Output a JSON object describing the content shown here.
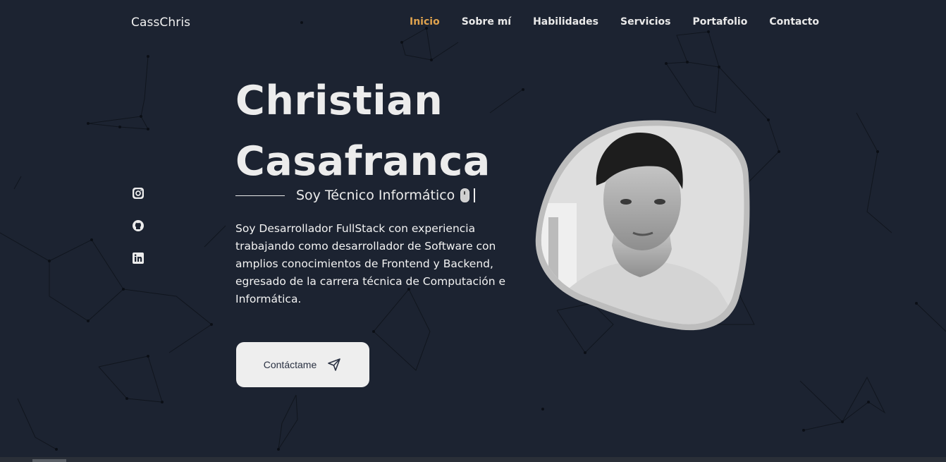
{
  "brand": {
    "name": "CassChris"
  },
  "nav": {
    "items": [
      {
        "label": "Inicio",
        "active": true
      },
      {
        "label": "Sobre mí",
        "active": false
      },
      {
        "label": "Habilidades",
        "active": false
      },
      {
        "label": "Servicios",
        "active": false
      },
      {
        "label": "Portafolio",
        "active": false
      },
      {
        "label": "Contacto",
        "active": false
      }
    ]
  },
  "social": [
    "instagram-icon",
    "github-icon",
    "linkedin-icon"
  ],
  "hero": {
    "name_line1": "Christian",
    "name_line2": "Casafranca",
    "subtitle": "Soy  Técnico Informático",
    "description": "Soy Desarrollador FullStack con experiencia trabajando como desarrollador de Software con amplios conocimientos de Frontend y Backend, egresado de la carrera técnica de Computación e Informática.",
    "cta_label": "Contáctame"
  },
  "colors": {
    "background": "#1c2331",
    "accent": "#e0a34e",
    "text": "#f1f1f1",
    "button_bg": "#eeeeee"
  }
}
